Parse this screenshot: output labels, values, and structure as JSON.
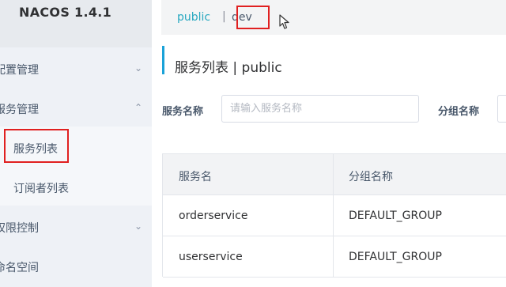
{
  "sidebar": {
    "brand": "NACOS 1.4.1",
    "menu": [
      {
        "label": "配置管理",
        "chevron": "⌄"
      },
      {
        "label": "服务管理",
        "chevron": "⌃"
      }
    ],
    "submenu": [
      {
        "label": "服务列表"
      },
      {
        "label": "订阅者列表"
      }
    ],
    "menu_bottom": [
      {
        "label": "权限控制",
        "chevron": "⌄"
      },
      {
        "label": "命名空间"
      }
    ]
  },
  "namespaces": {
    "public": "public",
    "separator": "|",
    "dev": "dev"
  },
  "page": {
    "title": "服务列表  |  public"
  },
  "filters": {
    "service_name_label": "服务名称",
    "service_name_placeholder": "请输入服务名称",
    "group_name_label": "分组名称"
  },
  "table": {
    "headers": [
      "服务名",
      "分组名称"
    ],
    "rows": [
      [
        "orderservice",
        "DEFAULT_GROUP"
      ],
      [
        "userservice",
        "DEFAULT_GROUP"
      ]
    ]
  },
  "colors": {
    "accent": "#1aa2d8",
    "namespace_active": "#28a8c0",
    "highlight": "#e02020"
  }
}
